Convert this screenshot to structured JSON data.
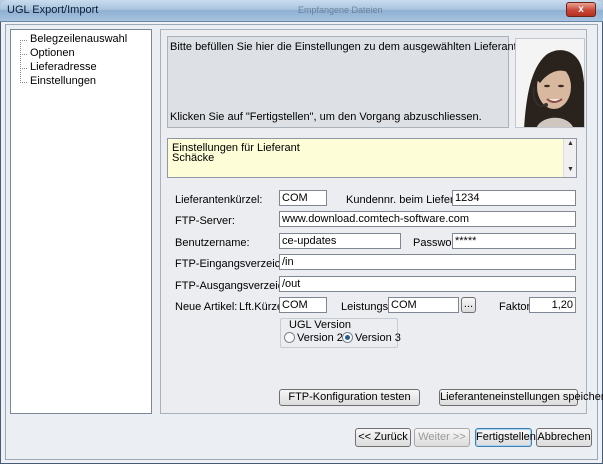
{
  "window": {
    "title": "UGL Export/Import",
    "background_title": "Empfangene Dateien",
    "close_symbol": "x"
  },
  "tree": {
    "items": [
      {
        "label": "Belegzeilenauswahl"
      },
      {
        "label": "Optionen"
      },
      {
        "label": "Lieferadresse"
      },
      {
        "label": "Einstellungen"
      }
    ]
  },
  "info": {
    "line1": "Bitte befüllen Sie hier die Einstellungen zu dem ausgewählten Lieferanten.",
    "line2": "Klicken Sie auf \"Fertigstellen\", um den Vorgang abzuschliessen."
  },
  "lieferant": {
    "line1": "Einstellungen für Lieferant",
    "line2": "Schäcke"
  },
  "form": {
    "kuerzel_label": "Lieferantenkürzel:",
    "kuerzel_value": "COM",
    "kundennr_label": "Kundennr. beim Lieferanten:",
    "kundennr_value": "1234",
    "ftp_server_label": "FTP-Server:",
    "ftp_server_value": "www.download.comtech-software.com",
    "benutzer_label": "Benutzername:",
    "benutzer_value": "ce-updates",
    "passwort_label": "Passwort:",
    "passwort_value": "*****",
    "eingang_label": "FTP-Eingangsverzeichnis:",
    "eingang_value": "/in",
    "ausgang_label": "FTP-Ausgangsverzeichnis:",
    "ausgang_value": "/out",
    "neue_artikel_label": "Neue Artikel:",
    "lft_kuerzel_label": "Lft.Kürzel:",
    "lft_kuerzel_value": "COM",
    "leistung_label": "Leistungsgr.:",
    "leistung_value": "COM",
    "browse_label": "...",
    "faktor_label": "Faktor:",
    "faktor_value": "1,20"
  },
  "ugl_version": {
    "title": "UGL Version",
    "option1": "Version 2",
    "option2": "Version 3",
    "selected": "Version 3"
  },
  "buttons": {
    "ftp_test": "FTP-Konfiguration testen",
    "save_settings": "Lieferanteneinstellungen speichern",
    "back": "<< Zurück",
    "next": "Weiter >>",
    "finish": "Fertigstellen",
    "cancel": "Abbrechen"
  },
  "colors": {
    "note_background": "#fdfdd8",
    "radio_selected": "#2a5b94",
    "titlebar": "#a9c4df"
  },
  "icons": [
    "close-icon",
    "tree-lines",
    "scroll-up-icon",
    "scroll-down-icon",
    "support-agent-photo"
  ]
}
